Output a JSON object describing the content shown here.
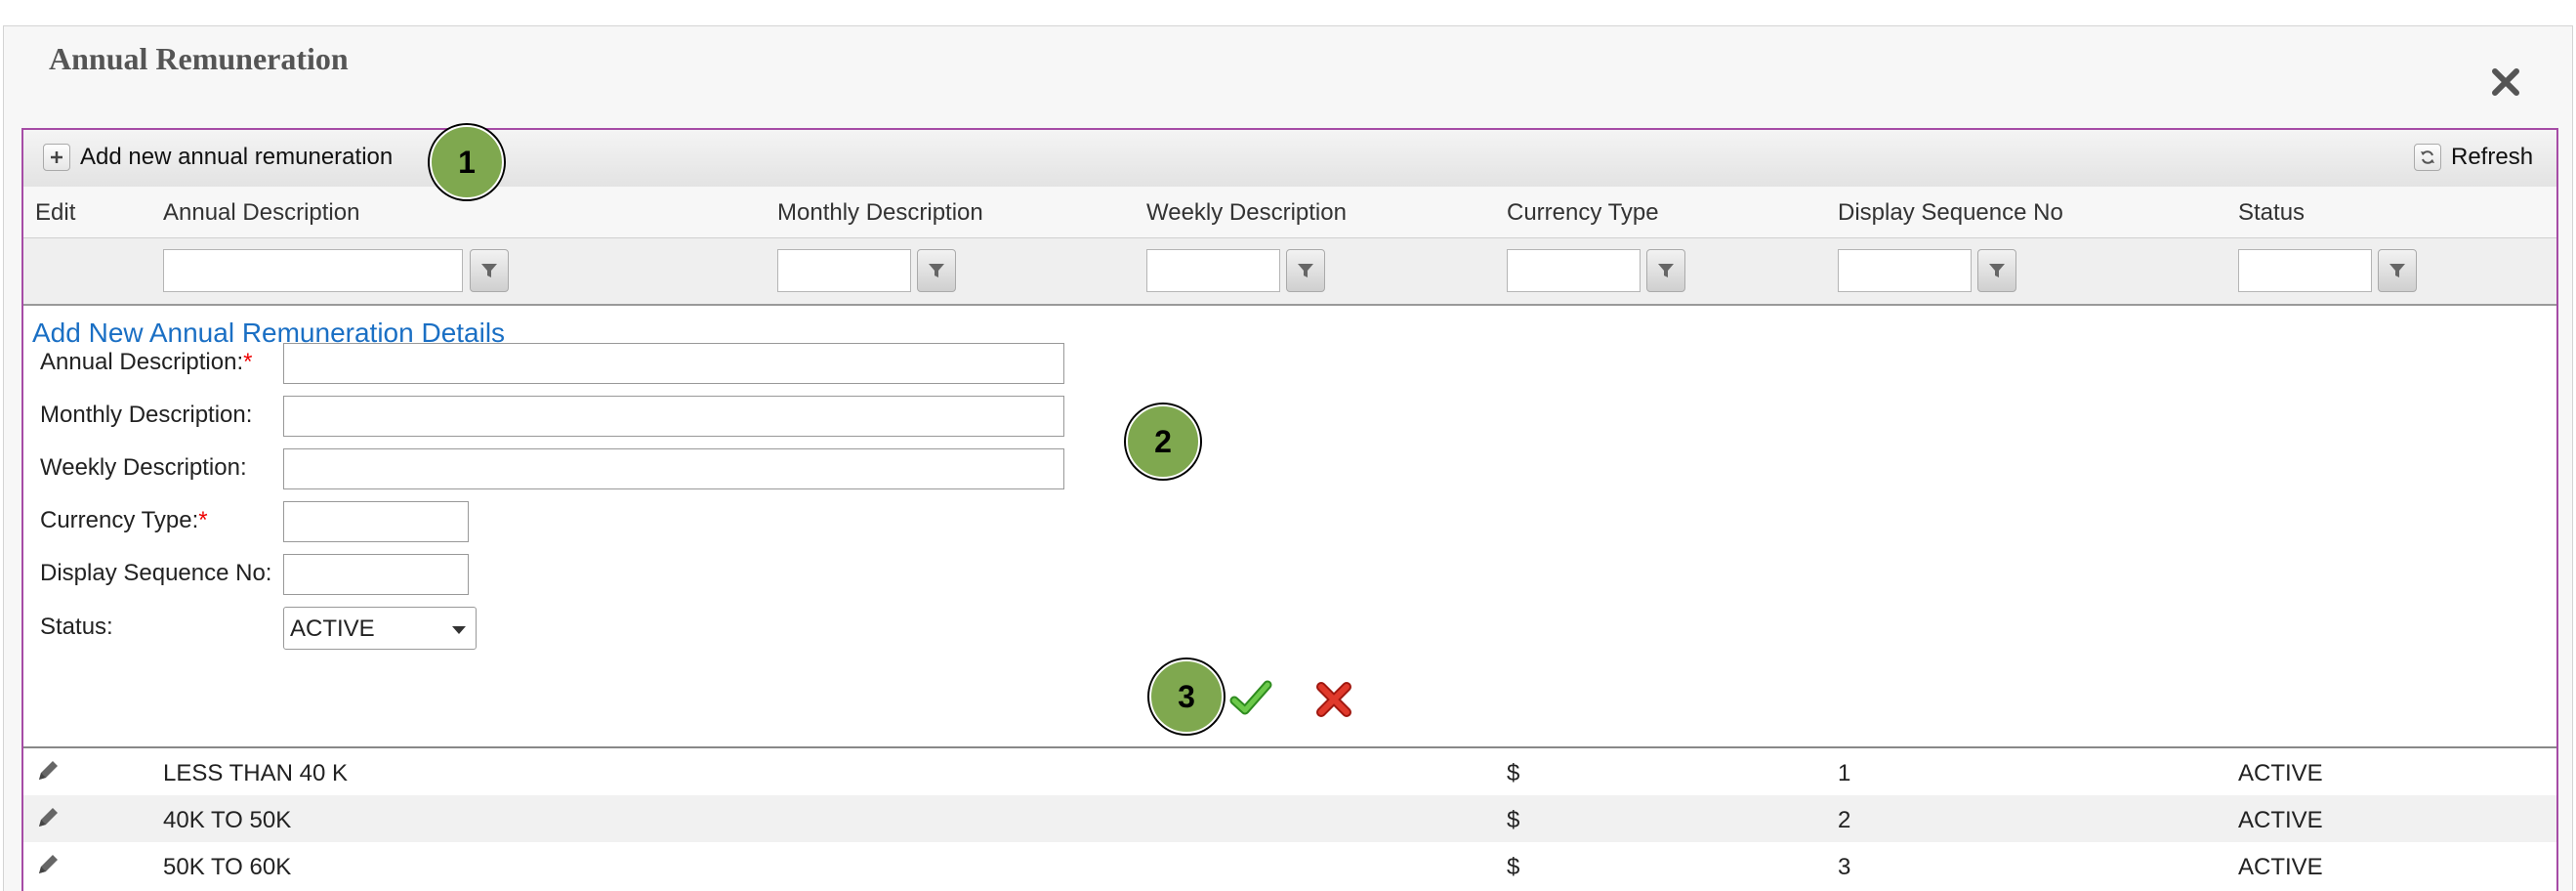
{
  "dialog": {
    "title": "Annual Remuneration",
    "close_icon": "close-icon"
  },
  "toolbar": {
    "add_label": "Add new annual remuneration",
    "refresh_label": "Refresh"
  },
  "columns": {
    "edit": "Edit",
    "annual": "Annual Description",
    "monthly": "Monthly Description",
    "weekly": "Weekly Description",
    "currency": "Currency Type",
    "sequence": "Display Sequence No",
    "status": "Status"
  },
  "form": {
    "title": "Add New Annual Remuneration Details",
    "annual_label": "Annual Description:",
    "monthly_label": "Monthly Description:",
    "weekly_label": "Weekly Description:",
    "currency_label": "Currency Type:",
    "sequence_label": "Display Sequence No:",
    "status_label": "Status:",
    "required_mark": "*",
    "status_value": "ACTIVE",
    "annual_value": "",
    "monthly_value": "",
    "weekly_value": "",
    "currency_value": "",
    "sequence_value": ""
  },
  "rows": [
    {
      "annual": "LESS THAN 40 K",
      "currency": "$",
      "sequence": "1",
      "status": "ACTIVE"
    },
    {
      "annual": "40K TO 50K",
      "currency": "$",
      "sequence": "2",
      "status": "ACTIVE"
    },
    {
      "annual": "50K TO 60K",
      "currency": "$",
      "sequence": "3",
      "status": "ACTIVE"
    }
  ],
  "annotations": [
    "1",
    "2",
    "3"
  ],
  "colors": {
    "grid_border": "#a64ca6",
    "form_title": "#1a6fc4",
    "badge": "#7fa84f",
    "save": "#4caf2a",
    "cancel": "#d12b1f"
  }
}
